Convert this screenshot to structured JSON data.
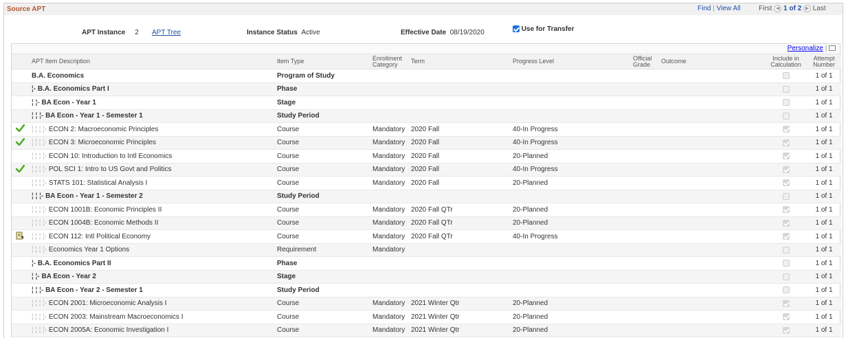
{
  "section": {
    "title": "Source APT",
    "find_label": "Find",
    "view_all_label": "View All",
    "first_label": "First",
    "pager_text": "1 of 2",
    "last_label": "Last"
  },
  "header": {
    "apt_instance_label": "APT Instance",
    "apt_instance_value": "2",
    "apt_tree_link": "APT Tree",
    "instance_status_label": "Instance Status",
    "instance_status_value": "Active",
    "effective_date_label": "Effective Date",
    "effective_date_value": "08/19/2020",
    "use_for_transfer_label": "Use for Transfer",
    "use_for_transfer_checked": true
  },
  "grid": {
    "personalize_label": "Personalize",
    "columns": {
      "description": "APT Item Description",
      "item_type": "Item Type",
      "enrollment_category_1": "Enrollment",
      "enrollment_category_2": "Category",
      "term": "Term",
      "progress_level": "Progress Level",
      "official_grade_1": "Official",
      "official_grade_2": "Grade",
      "outcome": "Outcome",
      "include_calc_1": "Include in",
      "include_calc_2": "Calculation",
      "attempt_number_1": "Attempt",
      "attempt_number_2": "Number"
    },
    "rows": [
      {
        "icon": "",
        "prefix": "",
        "desc": "B.A. Economics",
        "type": "Program of Study",
        "enroll": "",
        "term": "",
        "progress": "",
        "include": "",
        "attempt": "1 of 1",
        "bold": true
      },
      {
        "icon": "",
        "prefix": "¦- ",
        "desc": "B.A. Economics Part I",
        "type": "Phase",
        "enroll": "",
        "term": "",
        "progress": "",
        "include": "",
        "attempt": "1 of 1",
        "bold": true
      },
      {
        "icon": "",
        "prefix": "¦ ¦- ",
        "desc": "BA Econ - Year 1",
        "type": "Stage",
        "enroll": "",
        "term": "",
        "progress": "",
        "include": "",
        "attempt": "1 of 1",
        "bold": true
      },
      {
        "icon": "",
        "prefix": "¦ ¦ ¦- ",
        "desc": "BA Econ - Year 1 - Semester 1",
        "type": "Study Period",
        "enroll": "",
        "term": "",
        "progress": "",
        "include": "",
        "attempt": "1 of 1",
        "bold": true
      },
      {
        "icon": "check",
        "prefix": "¦ ¦ ¦ ¦- ",
        "desc": "ECON   2: Macroeconomic Principles",
        "type": "Course",
        "enroll": "Mandatory",
        "term": "2020 Fall",
        "progress": "40-In Progress",
        "include": "checked",
        "attempt": "1 of 1",
        "bold": false
      },
      {
        "icon": "check",
        "prefix": "¦ ¦ ¦ ¦- ",
        "desc": "ECON   3: Microeconomic Principles",
        "type": "Course",
        "enroll": "Mandatory",
        "term": "2020 Fall",
        "progress": "40-In Progress",
        "include": "checked",
        "attempt": "1 of 1",
        "bold": false
      },
      {
        "icon": "",
        "prefix": "¦ ¦ ¦ ¦- ",
        "desc": "ECON  10: Introduction to Intl Economics",
        "type": "Course",
        "enroll": "Mandatory",
        "term": "2020 Fall",
        "progress": "20-Planned",
        "include": "checked",
        "attempt": "1 of 1",
        "bold": false
      },
      {
        "icon": "check",
        "prefix": "¦ ¦ ¦ ¦- ",
        "desc": "POL SCI   1: Intro to US Govt and Politics",
        "type": "Course",
        "enroll": "Mandatory",
        "term": "2020 Fall",
        "progress": "40-In Progress",
        "include": "checked",
        "attempt": "1 of 1",
        "bold": false
      },
      {
        "icon": "",
        "prefix": "¦ ¦ ¦ ¦- ",
        "desc": "STATS  101: Statistical Analysis I",
        "type": "Course",
        "enroll": "Mandatory",
        "term": "2020 Fall",
        "progress": "20-Planned",
        "include": "checked",
        "attempt": "1 of 1",
        "bold": false
      },
      {
        "icon": "",
        "prefix": "¦ ¦ ¦- ",
        "desc": "BA Econ - Year 1 - Semester 2",
        "type": "Study Period",
        "enroll": "",
        "term": "",
        "progress": "",
        "include": "",
        "attempt": "1 of 1",
        "bold": true
      },
      {
        "icon": "",
        "prefix": "¦ ¦ ¦ ¦- ",
        "desc": "ECON 1001B: Economic Principles II",
        "type": "Course",
        "enroll": "Mandatory",
        "term": "2020 Fall QTr",
        "progress": "20-Planned",
        "include": "checked",
        "attempt": "1 of 1",
        "bold": false
      },
      {
        "icon": "",
        "prefix": "¦ ¦ ¦ ¦- ",
        "desc": "ECON 1004B: Economic Methods II",
        "type": "Course",
        "enroll": "Mandatory",
        "term": "2020 Fall QTr",
        "progress": "20-Planned",
        "include": "checked",
        "attempt": "1 of 1",
        "bold": false
      },
      {
        "icon": "doc",
        "prefix": "¦ ¦ ¦ ¦- ",
        "desc": "ECON  112: Intl Political Economy",
        "type": "Course",
        "enroll": "Mandatory",
        "term": "2020 Fall QTr",
        "progress": "40-In Progress",
        "include": "checked",
        "attempt": "1 of 1",
        "bold": false
      },
      {
        "icon": "",
        "prefix": "¦ ¦ ¦ ¦- ",
        "desc": "Economics Year 1 Options",
        "type": "Requirement",
        "enroll": "Mandatory",
        "term": "",
        "progress": "",
        "include": "",
        "attempt": "1 of 1",
        "bold": false
      },
      {
        "icon": "",
        "prefix": "¦- ",
        "desc": "B.A. Economics Part II",
        "type": "Phase",
        "enroll": "",
        "term": "",
        "progress": "",
        "include": "",
        "attempt": "1 of 1",
        "bold": true
      },
      {
        "icon": "",
        "prefix": "¦ ¦- ",
        "desc": "BA Econ - Year 2",
        "type": "Stage",
        "enroll": "",
        "term": "",
        "progress": "",
        "include": "",
        "attempt": "1 of 1",
        "bold": true
      },
      {
        "icon": "",
        "prefix": "¦ ¦ ¦- ",
        "desc": "BA Econ - Year 2 - Semester 1",
        "type": "Study Period",
        "enroll": "",
        "term": "",
        "progress": "",
        "include": "",
        "attempt": "1 of 1",
        "bold": true
      },
      {
        "icon": "",
        "prefix": "¦ ¦ ¦ ¦- ",
        "desc": "ECON 2001: Microeconomic Analysis I",
        "type": "Course",
        "enroll": "Mandatory",
        "term": "2021 Winter Qtr",
        "progress": "20-Planned",
        "include": "checked",
        "attempt": "1 of 1",
        "bold": false
      },
      {
        "icon": "",
        "prefix": "¦ ¦ ¦ ¦- ",
        "desc": "ECON 2003: Mainstream Macroeconomics I",
        "type": "Course",
        "enroll": "Mandatory",
        "term": "2021 Winter Qtr",
        "progress": "20-Planned",
        "include": "checked",
        "attempt": "1 of 1",
        "bold": false
      },
      {
        "icon": "",
        "prefix": "¦ ¦ ¦ ¦- ",
        "desc": "ECON 2005A: Economic Investigation I",
        "type": "Course",
        "enroll": "Mandatory",
        "term": "2021 Winter Qtr",
        "progress": "20-Planned",
        "include": "checked",
        "attempt": "1 of 1",
        "bold": false
      }
    ]
  },
  "colors": {
    "title": "#b5562d",
    "link": "#1f4fa8",
    "check": "#4caf22"
  }
}
